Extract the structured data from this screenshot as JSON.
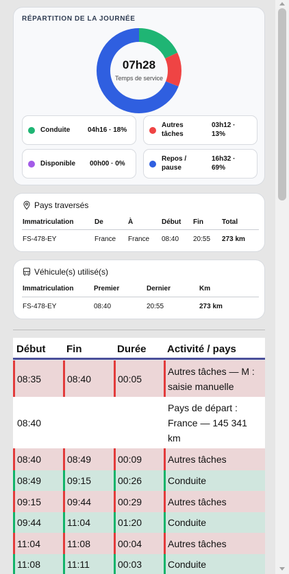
{
  "day": {
    "title": "RÉPARTITION DE LA JOURNÉE",
    "total": "07h28",
    "total_label": "Temps de service",
    "segments": [
      {
        "name": "Conduite",
        "fraction": 0.18,
        "color": "#1fb574"
      },
      {
        "name": "Autres tâches",
        "fraction": 0.13,
        "color": "#ef4444"
      },
      {
        "name": "Repos / pause",
        "fraction": 0.69,
        "color": "#2f5fe0"
      }
    ],
    "legend": [
      {
        "label": "Conduite",
        "value": "04h16 · 18%",
        "color": "#1fb574"
      },
      {
        "label": "Autres\ntâches",
        "value": "03h12 ·\n13%",
        "color": "#ef4444"
      },
      {
        "label": "Disponible",
        "value": "00h00 · 0%",
        "color": "#a35be8"
      },
      {
        "label": "Repos /\npause",
        "value": "16h32 ·\n69%",
        "color": "#2f5fe0"
      }
    ]
  },
  "countries": {
    "title": "Pays traversés",
    "headers": [
      "Immatriculation",
      "De",
      "À",
      "Début",
      "Fin",
      "Total"
    ],
    "row": [
      "FS-478-EY",
      "France",
      "France",
      "08:40",
      "20:55",
      "273 km"
    ]
  },
  "vehicles": {
    "title": "Véhicule(s) utilisé(s)",
    "headers": [
      "Immatriculation",
      "Premier",
      "Dernier",
      "Km"
    ],
    "row": [
      "FS-478-EY",
      "08:40",
      "20:55",
      "273 km"
    ]
  },
  "activities": {
    "headers": [
      "Début",
      "Fin",
      "Durée",
      "Activité / pays"
    ],
    "rows": [
      {
        "start": "08:35",
        "end": "08:40",
        "duration": "00:05",
        "activity": "Autres tâches — M :\nsaisie manuelle",
        "kind": "other"
      },
      {
        "start": "08:40",
        "end": "",
        "duration": "",
        "activity": "Pays de départ :\nFrance — 145 341\nkm",
        "kind": "info"
      },
      {
        "start": "08:40",
        "end": "08:49",
        "duration": "00:09",
        "activity": "Autres tâches",
        "kind": "other"
      },
      {
        "start": "08:49",
        "end": "09:15",
        "duration": "00:26",
        "activity": "Conduite",
        "kind": "drive"
      },
      {
        "start": "09:15",
        "end": "09:44",
        "duration": "00:29",
        "activity": "Autres tâches",
        "kind": "other"
      },
      {
        "start": "09:44",
        "end": "11:04",
        "duration": "01:20",
        "activity": "Conduite",
        "kind": "drive"
      },
      {
        "start": "11:04",
        "end": "11:08",
        "duration": "00:04",
        "activity": "Autres tâches",
        "kind": "other"
      },
      {
        "start": "11:08",
        "end": "11:11",
        "duration": "00:03",
        "activity": "Conduite",
        "kind": "drive"
      }
    ]
  },
  "colors": {
    "other_bg": "#ecd6d7",
    "other_bar": "#e23b3b",
    "drive_bg": "#d0e6de",
    "drive_bar": "#12b36a",
    "info_bg": "#ffffff"
  }
}
